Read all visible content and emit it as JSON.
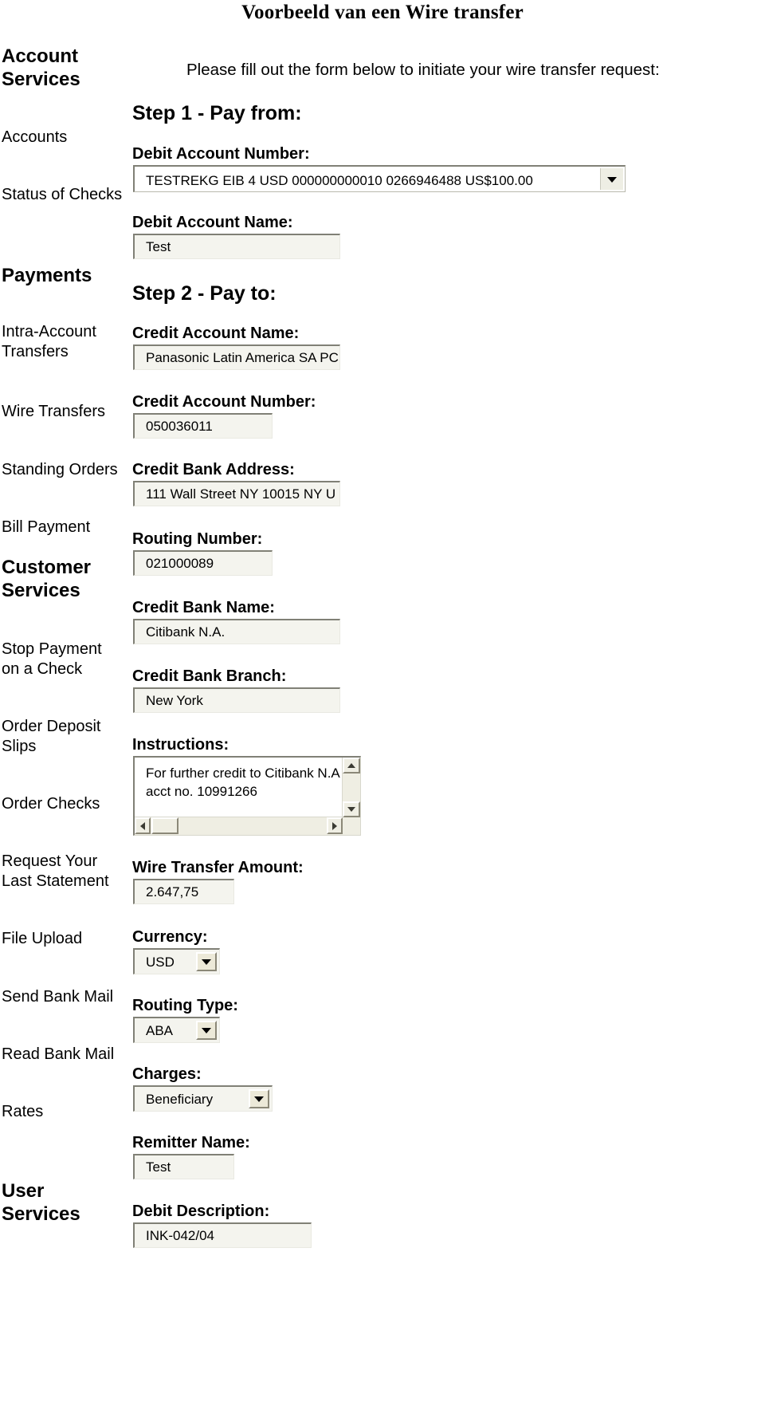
{
  "page": {
    "title": "Voorbeeld van een Wire transfer",
    "intro": "Please fill out the form below to initiate your wire transfer request:"
  },
  "sidebar": {
    "groups": [
      {
        "label": "Account Services",
        "type": "group"
      },
      {
        "label": "Accounts",
        "type": "link"
      },
      {
        "label": "Status of Checks",
        "type": "link"
      },
      {
        "label": "Payments",
        "type": "group"
      },
      {
        "label": "Intra-Account Transfers",
        "type": "link"
      },
      {
        "label": "Wire Transfers",
        "type": "link"
      },
      {
        "label": "Standing Orders",
        "type": "link"
      },
      {
        "label": "Bill Payment",
        "type": "link"
      },
      {
        "label": "Customer Services",
        "type": "group"
      },
      {
        "label": "Stop Payment on a Check",
        "type": "link"
      },
      {
        "label": "Order Deposit Slips",
        "type": "link"
      },
      {
        "label": "Order Checks",
        "type": "link"
      },
      {
        "label": "Request Your Last Statement",
        "type": "link"
      },
      {
        "label": "File Upload",
        "type": "link"
      },
      {
        "label": "Send Bank Mail",
        "type": "link"
      },
      {
        "label": "Read Bank Mail",
        "type": "link"
      },
      {
        "label": "Rates",
        "type": "link"
      },
      {
        "label": "User Services",
        "type": "group"
      }
    ],
    "items": {
      "account_services": "Account Services",
      "account_services_l1": "Account",
      "account_services_l2": "Services",
      "accounts": "Accounts",
      "status_of_checks": "Status of Checks",
      "payments": "Payments",
      "intra_account_l1": "Intra-Account",
      "intra_account_l2": "Transfers",
      "wire_transfers": "Wire Transfers",
      "standing_orders": "Standing Orders",
      "bill_payment": "Bill Payment",
      "customer_services_l1": "Customer",
      "customer_services_l2": "Services",
      "stop_payment_l1": "Stop Payment",
      "stop_payment_l2": "on a Check",
      "order_deposit_l1": "Order Deposit",
      "order_deposit_l2": "Slips",
      "order_checks": "Order Checks",
      "request_statement_l1": "Request Your",
      "request_statement_l2": "Last Statement",
      "file_upload": "File Upload",
      "send_bank_mail": "Send Bank Mail",
      "read_bank_mail": "Read Bank Mail",
      "rates": "Rates",
      "user_services_l1": "User",
      "user_services_l2": "Services"
    }
  },
  "form": {
    "step1_heading": "Step 1 - Pay from:",
    "step2_heading": "Step 2 - Pay to:",
    "fields": {
      "debit_account_number": {
        "label": "Debit Account Number:",
        "value": "TESTREKG EIB 4 USD   000000000010   0266946488   US$100.00"
      },
      "debit_account_name": {
        "label": "Debit Account Name:",
        "value": "Test"
      },
      "credit_account_name": {
        "label": "Credit Account Name:",
        "value": "Panasonic Latin America SA PC"
      },
      "credit_account_number": {
        "label": "Credit Account Number:",
        "value": "050036011"
      },
      "credit_bank_address": {
        "label": "Credit Bank Address:",
        "value": "111 Wall Street NY 10015 NY U"
      },
      "routing_number": {
        "label": "Routing Number:",
        "value": "021000089"
      },
      "credit_bank_name": {
        "label": "Credit Bank Name:",
        "value": "Citibank N.A."
      },
      "credit_bank_branch": {
        "label": "Credit Bank Branch:",
        "value": "New York"
      },
      "instructions": {
        "label": "Instructions:",
        "line1": "For further credit to Citibank N.A",
        "line2": "acct no. 10991266"
      },
      "wire_transfer_amount": {
        "label": "Wire Transfer Amount:",
        "value": "2.647,75"
      },
      "currency": {
        "label": "Currency:",
        "value": "USD"
      },
      "routing_type": {
        "label": "Routing Type:",
        "value": "ABA"
      },
      "charges": {
        "label": "Charges:",
        "value": "Beneficiary"
      },
      "remitter_name": {
        "label": "Remitter Name:",
        "value": "Test"
      },
      "debit_description": {
        "label": "Debit Description:",
        "value": "INK-042/04"
      }
    }
  }
}
